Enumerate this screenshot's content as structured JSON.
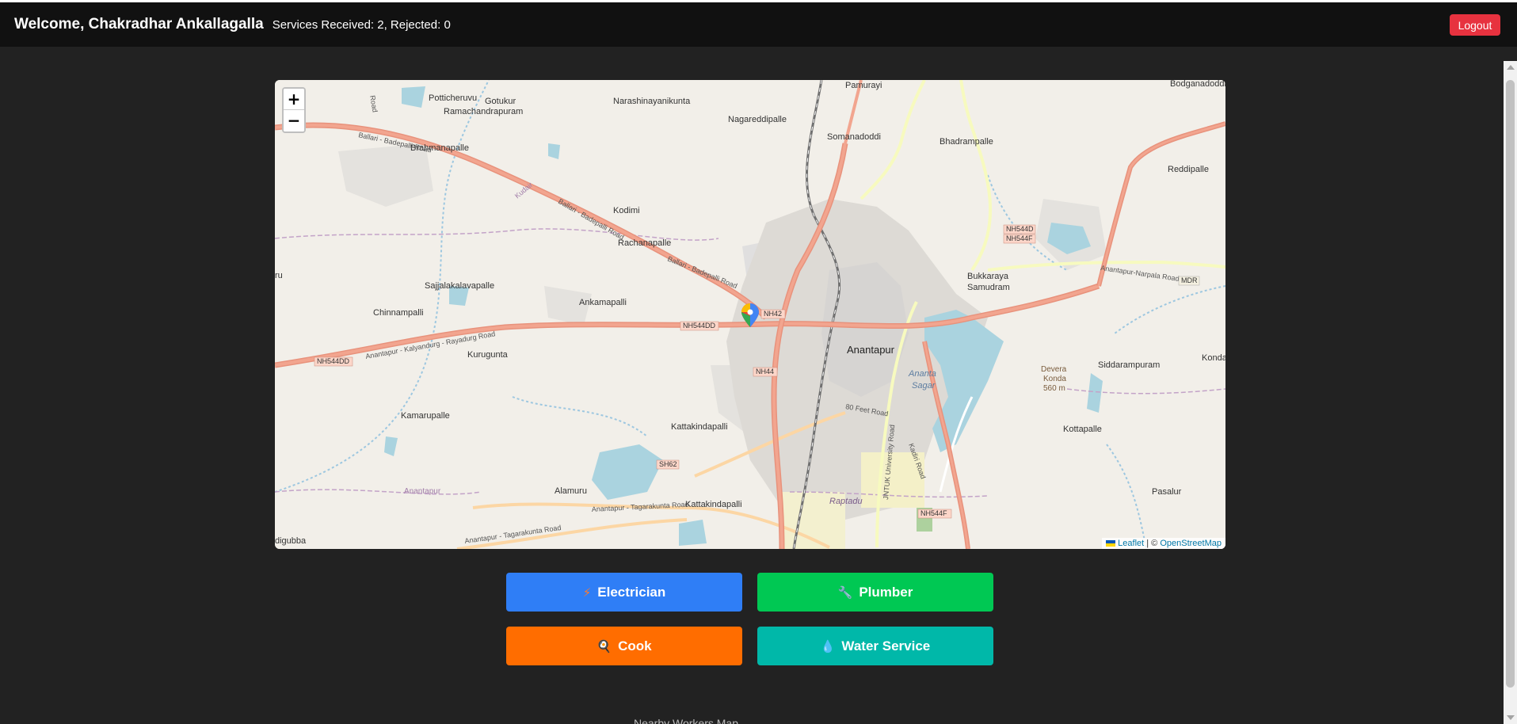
{
  "header": {
    "welcome": "Welcome, Chakradhar Ankallagalla",
    "stats": "Services Received: 2, Rejected: 0",
    "logout_label": "Logout"
  },
  "map": {
    "zoom_in": "+",
    "zoom_out": "−",
    "labels": {
      "pamurayi": "Pamurayi",
      "bodganadoddi": "Bodganadoddi",
      "potticheruvu": "Potticheruvu",
      "gotukur": "Gotukur",
      "narashinayanikunta": "Narashinayanikunta",
      "ramachandrapuram": "Ramachandrapuram",
      "nagareddipalle": "Nagareddipalle",
      "brahmanapalle": "Brahmanapalle",
      "somanadoddi": "Somanadoddi",
      "bhadrampalle": "Bhadrampalle",
      "reddipalle": "Reddipalle",
      "kodimi": "Kodimi",
      "rachanapalle": "Rachanapalle",
      "sajjalakalavapalle": "Sajjalakalavapalle",
      "bukkaraya": "Bukkaraya",
      "samudram": "Samudram",
      "chinnampalli": "Chinnampalli",
      "ankamapalli": "Ankamapalli",
      "anantapur": "Anantapur",
      "kurugunta": "Kurugunta",
      "ananta": "Ananta",
      "sagar": "Sagar",
      "siddarampuram": "Siddarampuram",
      "konda": "Kondap",
      "devera": "Devera",
      "konda2": "Konda",
      "elev": "560 m",
      "kamarupalle": "Kamarupalle",
      "kattakindapalli1": "Kattakindapalli",
      "kottapalle": "Kottapalle",
      "alamuru": "Alamuru",
      "kattakindapalli2": "Kattakindapalli",
      "pasalur": "Pasalur",
      "anantapur_small": "Anantapur",
      "raptadu": "Raptadu",
      "digubba": "digubba",
      "ru": "ru"
    },
    "roads": {
      "nh544d_a": "NH544D",
      "nh544f_a": "NH544F",
      "nh42": "NH42",
      "nh544dd_a": "NH544DD",
      "nh544dd_b": "NH544DD",
      "nh44": "NH44",
      "sh62": "SH62",
      "nh544f_b": "NH544F",
      "mdr": "MDR",
      "ballari1": "Ballari - Badepalli Road",
      "ballari2": "Ballari - Badepalli Road",
      "ballari3": "Ballari - Badepalli Road",
      "kalyandurg": "Anantapur - Kalyandurg - Rayadurg Road",
      "narpala": "Anantapur-Narpala Road",
      "feet80": "80 Feet Road",
      "jntuk": "JNTUK University Road",
      "tagarakunta1": "Anantapur - Tagarakunta Road",
      "tagarakunta2": "Anantapur - Tagarakunta Road",
      "kurugodu": "Kudair",
      "road_v": "Road",
      "kadiri": "Kadiri Road"
    },
    "attribution": {
      "leaflet": "Leaflet",
      "separator": " | © ",
      "osm": "OpenStreetMap"
    }
  },
  "services": [
    {
      "label": "Electrician",
      "icon": "⚡",
      "color": "#2f7ef6"
    },
    {
      "label": "Plumber",
      "icon": "🔧",
      "color": "#00c853"
    },
    {
      "label": "Cook",
      "icon": "🍳",
      "color": "#ff6d00"
    },
    {
      "label": "Water Service",
      "icon": "💧",
      "color": "#00b8a9"
    }
  ],
  "footer_cut": "Nearby Workers Map..."
}
